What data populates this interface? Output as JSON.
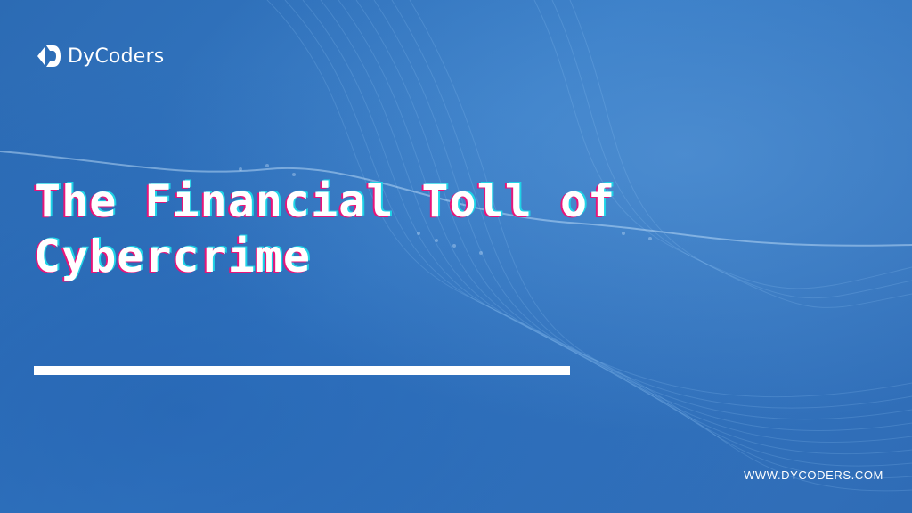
{
  "brand": {
    "name": "DyCoders",
    "logo_icon": "dycoders-logo-icon"
  },
  "headline": {
    "line1": "The Financial Toll of",
    "line2": "Cybercrime"
  },
  "footer": {
    "website": "WWW.DYCODERS.COM"
  },
  "colors": {
    "background": "#2f6fb8",
    "text": "#ffffff",
    "glitch_magenta": "#e8157a",
    "glitch_cyan": "#1fd3e6"
  }
}
